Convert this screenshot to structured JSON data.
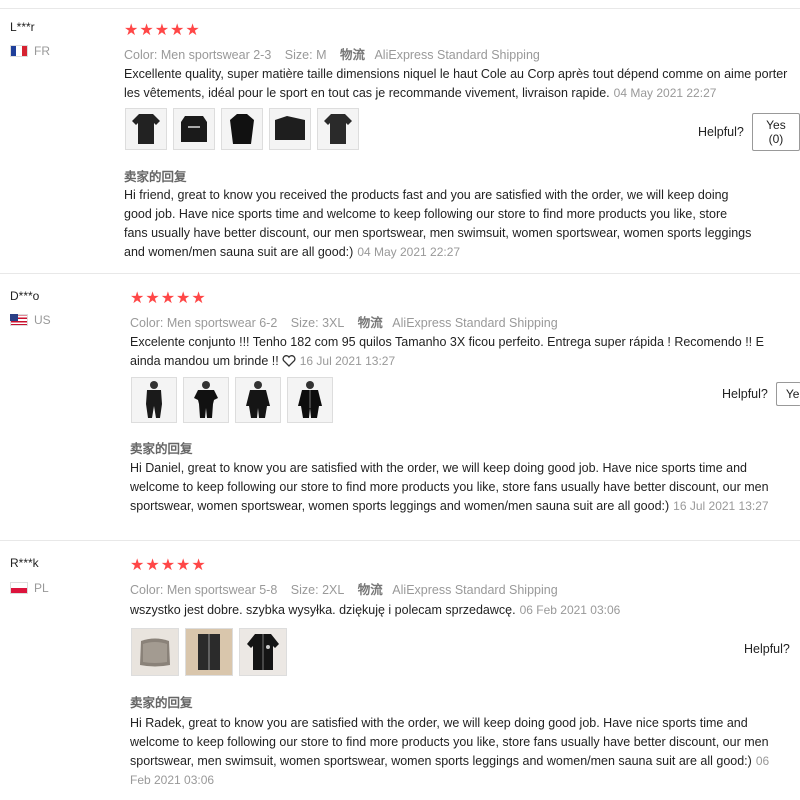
{
  "common": {
    "helpful_label": "Helpful?",
    "seller_label": "卖家的回复",
    "stars": "★★★★★",
    "color_key": "Color:",
    "size_key": "Size:",
    "shipping_key": "物流"
  },
  "reviews": [
    {
      "user": "L***r",
      "country": "FR",
      "color": "Men sportswear 2-3",
      "size": "M",
      "shipping": "AliExpress Standard Shipping",
      "text": "Excellente quality, super matière taille dimensions niquel le haut Cole au Corp après tout dépend comme on aime porter les vêtements, idéal pour le sport en tout cas je recommande vivement, livraison rapide.",
      "date": "04 May 2021 22:27",
      "helpful_button": "Yes (0)",
      "reply": "Hi friend, great to know you received the products fast and you are satisfied with the order, we will keep doing good job. Have nice sports time and welcome to keep following our store to find more products you like, store fans usually have better discount, our men sportswear, men swimsuit, women sportswear, women sports leggings and women/men sauna suit are all good:)",
      "reply_date": "04 May 2021 22:27"
    },
    {
      "user": "D***o",
      "country": "US",
      "color": "Men sportswear 6-2",
      "size": "3XL",
      "shipping": "AliExpress Standard Shipping",
      "text": "Excelente conjunto !!! Tenho 182 com 95 quilos Tamanho 3X ficou perfeito. Entrega super rápida ! Recomendo !! E ainda mandou um brinde !!",
      "date": "16 Jul 2021 13:27",
      "helpful_button": "Ye",
      "reply": "Hi Daniel, great to know you are satisfied with the order, we will keep doing good job. Have nice sports time and welcome to keep following our store to find more products you like, store fans usually have better discount, our men sportswear, women sportswear, women sports leggings and women/men sauna suit are all good:)",
      "reply_date": "16 Jul 2021 13:27"
    },
    {
      "user": "R***k",
      "country": "PL",
      "color": "Men sportswear 5-8",
      "size": "2XL",
      "shipping": "AliExpress Standard Shipping",
      "text": "wszystko jest dobre. szybka wysyłka. dziękuję i polecam sprzedawcę.",
      "date": "06 Feb 2021 03:06",
      "reply": "Hi Radek, great to know you are satisfied with the order, we will keep doing good job. Have nice sports time and welcome to keep following our store to find more products you like, store fans usually have better discount, our men sportswear, men swimsuit, women sportswear, women sports leggings and women/men sauna suit are all good:)",
      "reply_date": "06 Feb 2021 03:06"
    }
  ]
}
